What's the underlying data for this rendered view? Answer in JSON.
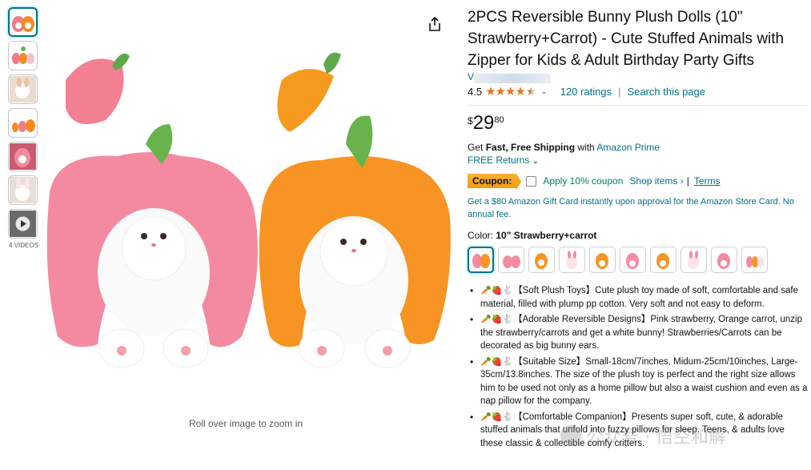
{
  "thumbnails": {
    "count_label": "4 VIDEOS"
  },
  "main": {
    "zoom_hint": "Roll over image to zoom in"
  },
  "product": {
    "title": "2PCS Reversible Bunny Plush Dolls (10\" Strawberry+Carrot) - Cute Stuffed Animals with Zipper for Kids & Adult Birthday Party Gifts",
    "brand_initial": "V",
    "rating": "4.5",
    "rating_count": "120 ratings",
    "search_page": "Search this page",
    "price": {
      "symbol": "$",
      "whole": "29",
      "fraction": "80"
    },
    "shipping_prefix": "Get ",
    "shipping_bold": "Fast, Free Shipping",
    "shipping_with": " with ",
    "shipping_link": "Amazon Prime",
    "returns": "FREE Returns",
    "coupon": {
      "badge": "Coupon:",
      "apply": "Apply 10% coupon",
      "shop_items": "Shop items ›",
      "sep": "|",
      "terms": "Terms"
    },
    "gift_card": "Get a $80 Amazon Gift Card instantly upon approval for the Amazon Store Card. No annual fee.",
    "color_label": "Color: ",
    "color_value": "10\" Strawberry+carrot",
    "bullets": [
      {
        "emoji": "🥕🍓🐇",
        "text": "【Soft Plush Toys】Cute plush toy made of soft, comfortable and safe material, filled with plump pp cotton. Very soft and not easy to deform."
      },
      {
        "emoji": "🥕🍓🐇",
        "text": "【Adorable Reversible Designs】Pink strawberry, Orange carrot, unzip the strawberry/carrots and get a white bunny! Strawberries/Carrots can be decorated as big bunny ears."
      },
      {
        "emoji": "🥕🍓🐇",
        "text": "【Suitable Size】Small-18cm/7inches, Midum-25cm/10inches, Large-35cm/13.8inches. The size of the plush toy is perfect and the right size allows him to be used not only as a home pillow but also a waist cushion and even as a nap pillow for the company."
      },
      {
        "emoji": "🥕🍓🐇",
        "text": "【Comfortable Companion】Presents super soft, cute, & adorable stuffed animals that unfold into fuzzy pillows for sleep. Teens, & adults love these classic & collectible comfy critters."
      }
    ]
  },
  "watermark": "公众号 · 悟空和解",
  "colors": {
    "link": "#007185",
    "star": "#de7921",
    "coupon": "#f5a623",
    "green": "#067d62"
  }
}
